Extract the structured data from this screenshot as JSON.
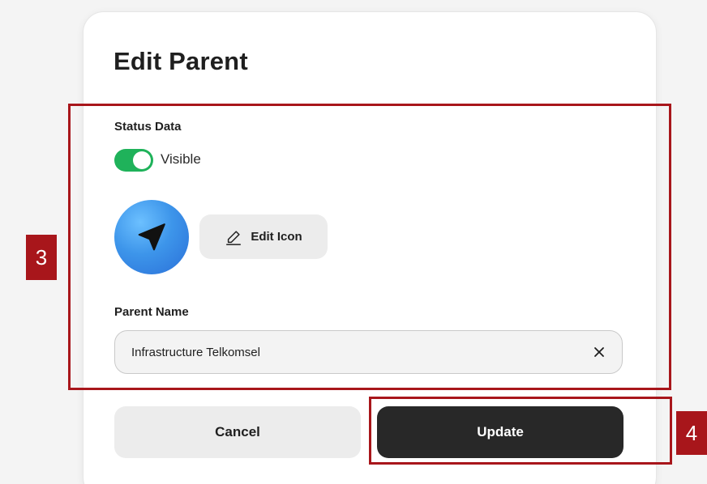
{
  "dialog": {
    "title": "Edit Parent"
  },
  "status": {
    "label": "Status Data",
    "toggle_on": true,
    "toggle_label": "Visible",
    "toggle_color": "#1fb25a"
  },
  "icon_section": {
    "icon": "navigation-arrow-icon",
    "icon_bg_color": "#3d95ea",
    "edit_button_label": "Edit Icon",
    "edit_button_icon": "pencil-icon"
  },
  "parent_name": {
    "label": "Parent Name",
    "value": "Infrastructure Telkomsel",
    "clear_icon": "close-icon"
  },
  "actions": {
    "cancel_label": "Cancel",
    "update_label": "Update",
    "update_color": "#282828"
  },
  "annotations": [
    {
      "label": "3",
      "color": "#a8161b"
    },
    {
      "label": "4",
      "color": "#a8161b"
    }
  ]
}
